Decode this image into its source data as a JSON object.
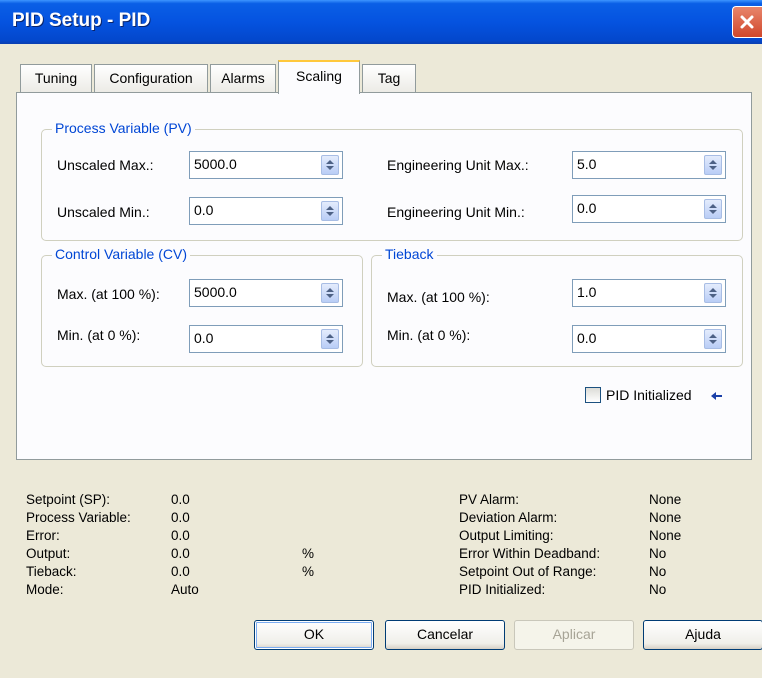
{
  "window": {
    "title": "PID Setup - PID"
  },
  "tabs": [
    "Tuning",
    "Configuration",
    "Alarms",
    "Scaling",
    "Tag"
  ],
  "pv_group": {
    "title": "Process Variable (PV)",
    "unscaled_max_label": "Unscaled Max.:",
    "unscaled_max_value": "5000.0",
    "unscaled_min_label": "Unscaled Min.:",
    "unscaled_min_value": "0.0",
    "eu_max_label": "Engineering Unit Max.:",
    "eu_max_value": "5.0",
    "eu_min_label": "Engineering Unit Min.:",
    "eu_min_value": "0.0"
  },
  "cv_group": {
    "title": "Control Variable (CV)",
    "max_label": "Max. (at 100 %):",
    "max_value": "5000.0",
    "min_label": "Min. (at 0 %):",
    "min_value": "0.0"
  },
  "tieback_group": {
    "title": "Tieback",
    "max_label": "Max. (at 100 %):",
    "max_value": "1.0",
    "min_label": "Min. (at 0 %):",
    "min_value": "0.0"
  },
  "pid_initialized": {
    "label": "PID Initialized",
    "checked": false
  },
  "status_left": {
    "labels": [
      "Setpoint (SP):",
      "Process Variable:",
      "Error:",
      "Output:",
      "Tieback:",
      "Mode:"
    ],
    "values": [
      "0.0",
      "0.0",
      "0.0",
      "0.0",
      "0.0",
      "Auto"
    ],
    "units": [
      "",
      "",
      "",
      "%",
      "%",
      ""
    ]
  },
  "status_right": {
    "labels": [
      "PV Alarm:",
      "Deviation Alarm:",
      "Output Limiting:",
      "Error Within Deadband:",
      "Setpoint Out of Range:",
      "PID Initialized:"
    ],
    "values": [
      "None",
      "None",
      "None",
      "No",
      "No",
      "No"
    ]
  },
  "buttons": {
    "ok": "OK",
    "cancel": "Cancelar",
    "apply": "Aplicar",
    "help": "Ajuda"
  },
  "colors": {
    "titlebar": "#0553e0",
    "group_title": "#0046d5",
    "tab_highlight": "#ffc83c",
    "background": "#ece9d8"
  }
}
